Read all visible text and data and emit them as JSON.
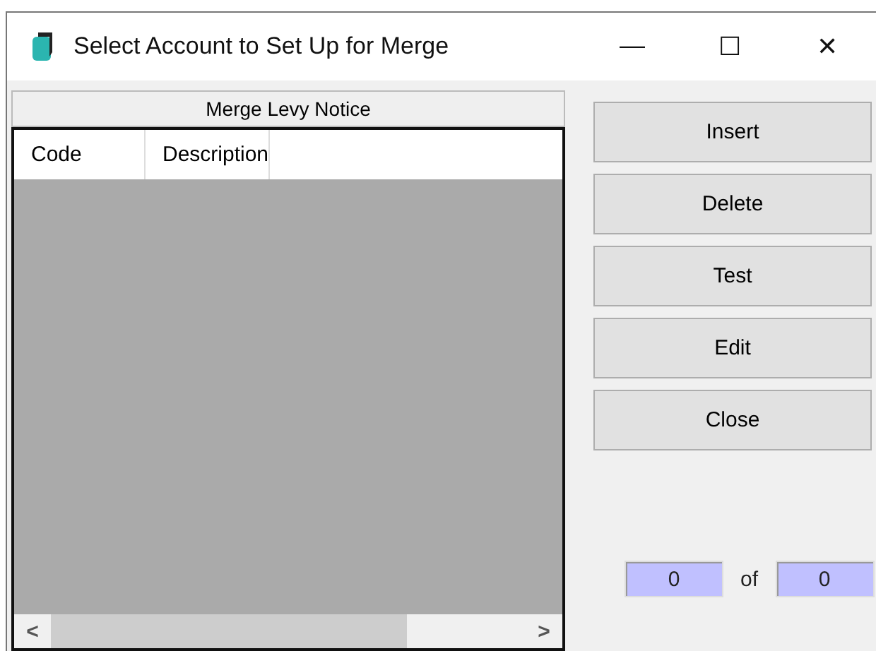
{
  "window": {
    "title": "Select Account to Set Up for Merge",
    "controls": [
      "—",
      "☐",
      "✕"
    ]
  },
  "grid": {
    "caption": "Merge Levy Notice",
    "columns": [
      "Code",
      "Description"
    ],
    "scroll_left": "<",
    "scroll_right": ">"
  },
  "buttons": [
    "Insert",
    "Delete",
    "Test",
    "Edit",
    "Close"
  ],
  "record_counter": {
    "current": "0",
    "separator": "of",
    "total": "0"
  }
}
